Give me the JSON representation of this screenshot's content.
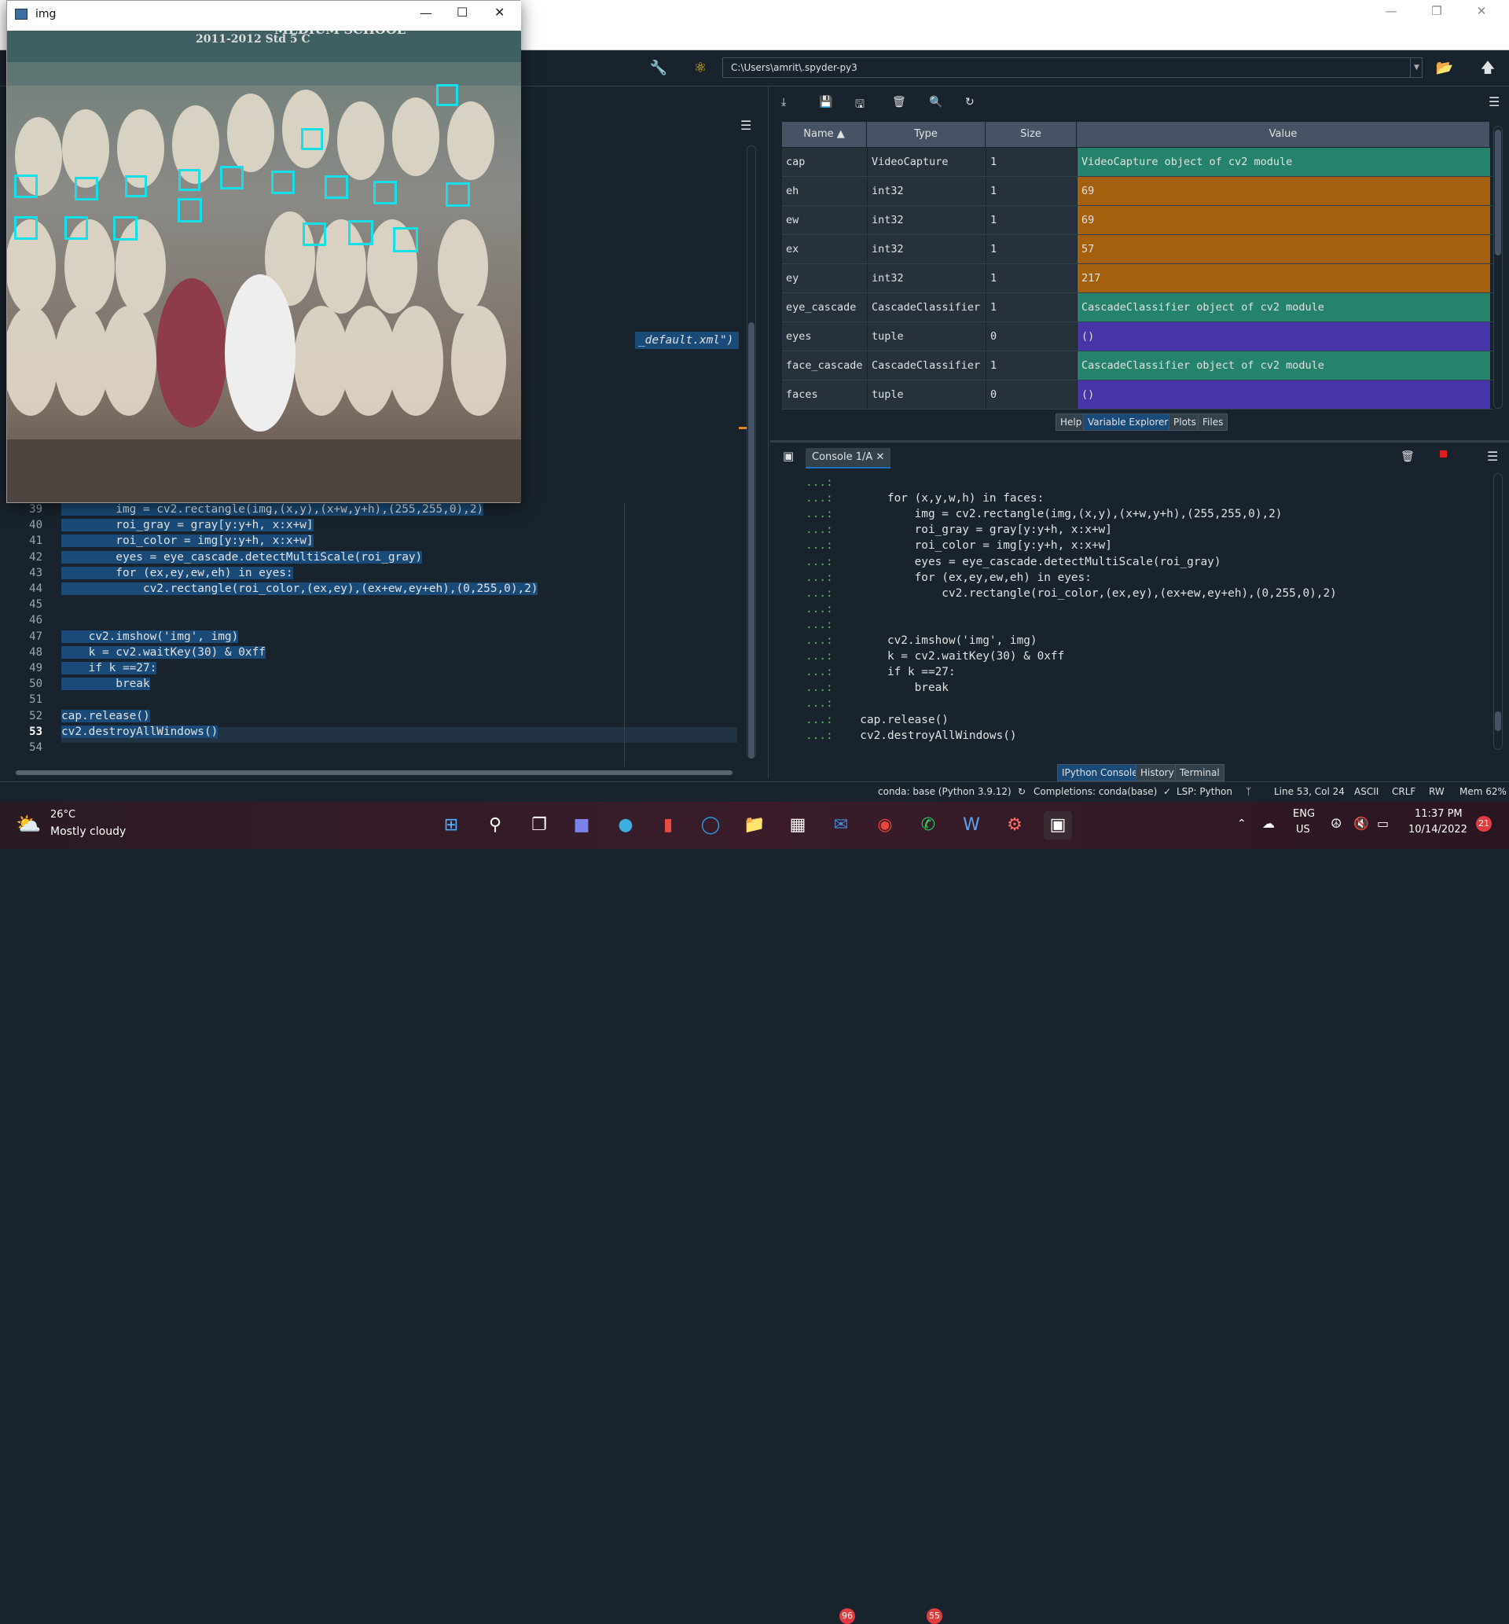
{
  "image_window": {
    "title": "img",
    "photo_caption_top": "2011-2012   Std 5 C",
    "photo_header": "MEDIUM SCHOOL"
  },
  "toolbar": {
    "path": "C:\\Users\\amrit\\.spyder-py3"
  },
  "editor": {
    "right_fragment": "_default.xml\")",
    "line_numbers": [
      "39",
      "40",
      "41",
      "42",
      "43",
      "44",
      "45",
      "46",
      "47",
      "48",
      "49",
      "50",
      "51",
      "52",
      "53",
      "54"
    ],
    "lines": [
      "        img = cv2.rectangle(img,(x,y),(x+w,y+h),(255,255,0),2)",
      "        roi_gray = gray[y:y+h, x:x+w]",
      "        roi_color = img[y:y+h, x:x+w]",
      "        eyes = eye_cascade.detectMultiScale(roi_gray)",
      "        for (ex,ey,ew,eh) in eyes:",
      "            cv2.rectangle(roi_color,(ex,ey),(ex+ew,ey+eh),(0,255,0),2)",
      "",
      "",
      "    cv2.imshow('img', img)",
      "    k = cv2.waitKey(30) & 0xff",
      "    if k ==27:",
      "        break",
      "",
      "cap.release()",
      "cv2.destroyAllWindows()",
      ""
    ]
  },
  "variable_explorer": {
    "columns": [
      "Name",
      "Type",
      "Size",
      "Value"
    ],
    "rows": [
      {
        "name": "cap",
        "type": "VideoCapture",
        "size": "1",
        "value": "VideoCapture object of cv2 module",
        "color": "#26836b"
      },
      {
        "name": "eh",
        "type": "int32",
        "size": "1",
        "value": "69",
        "color": "#a5600e"
      },
      {
        "name": "ew",
        "type": "int32",
        "size": "1",
        "value": "69",
        "color": "#a5600e"
      },
      {
        "name": "ex",
        "type": "int32",
        "size": "1",
        "value": "57",
        "color": "#a5600e"
      },
      {
        "name": "ey",
        "type": "int32",
        "size": "1",
        "value": "217",
        "color": "#a5600e"
      },
      {
        "name": "eye_cascade",
        "type": "CascadeClassifier",
        "size": "1",
        "value": "CascadeClassifier object of cv2 module",
        "color": "#26836b"
      },
      {
        "name": "eyes",
        "type": "tuple",
        "size": "0",
        "value": "()",
        "color": "#4535a8"
      },
      {
        "name": "face_cascade",
        "type": "CascadeClassifier",
        "size": "1",
        "value": "CascadeClassifier object of cv2 module",
        "color": "#26836b"
      },
      {
        "name": "faces",
        "type": "tuple",
        "size": "0",
        "value": "()",
        "color": "#4535a8"
      }
    ],
    "tabs": [
      "Help",
      "Variable Explorer",
      "Plots",
      "Files"
    ]
  },
  "console": {
    "tab_label": "Console 1/A",
    "prompt": "...:",
    "lines": [
      "",
      "        for (x,y,w,h) in faces:",
      "            img = cv2.rectangle(img,(x,y),(x+w,y+h),(255,255,0),2)",
      "            roi_gray = gray[y:y+h, x:x+w]",
      "            roi_color = img[y:y+h, x:x+w]",
      "            eyes = eye_cascade.detectMultiScale(roi_gray)",
      "            for (ex,ey,ew,eh) in eyes:",
      "                cv2.rectangle(roi_color,(ex,ey),(ex+ew,ey+eh),(0,255,0),2)",
      "",
      "",
      "        cv2.imshow('img', img)",
      "        k = cv2.waitKey(30) & 0xff",
      "        if k ==27:",
      "            break",
      "",
      "    cap.release()",
      "    cv2.destroyAllWindows()"
    ],
    "tabs": [
      "IPython Console",
      "History",
      "Terminal"
    ]
  },
  "status_bar": {
    "env": "conda: base (Python 3.9.12)",
    "completions": "Completions: conda(base)",
    "lsp": "LSP: Python",
    "position": "Line 53, Col 24",
    "encoding": "ASCII",
    "eol": "CRLF",
    "mode": "RW",
    "mem": "Mem 62%"
  },
  "taskbar": {
    "weather_temp": "26°C",
    "weather_desc": "Mostly cloudy",
    "lang": "ENG",
    "region": "US",
    "time": "11:37 PM",
    "date": "10/14/2022",
    "notif_count": "21",
    "mail_badge": "96",
    "whatsapp_badge": "55"
  }
}
